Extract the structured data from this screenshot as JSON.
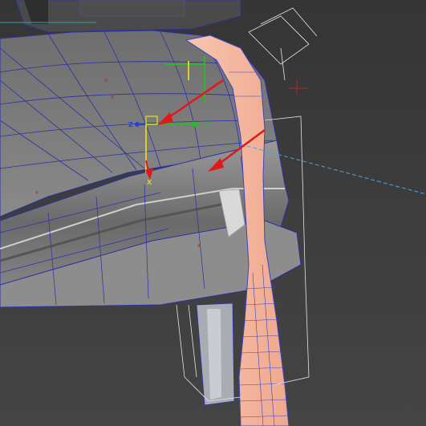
{
  "viewport": {
    "colors": {
      "background": "#3c3c3c",
      "mesh_fill": "#7c7c7c",
      "wire": "#2b2fa8",
      "selected_fill": "#f4b49b",
      "selected_wire": "#3845c8",
      "gizmo_x": "#d6d02a",
      "gizmo_y": "#2fb62f",
      "gizmo_z": "#2a3fe0",
      "arrow": "#e01818",
      "bounding_box": "#e6e6e6",
      "light_ray": "#4ea3e0"
    },
    "gizmo": {
      "label_x": "X",
      "label_y": "Y",
      "label_z": "Z"
    },
    "pivot_markers": [
      "x",
      "x",
      "x",
      "x"
    ],
    "icons": [
      "move-gizmo-icon",
      "annotation-arrow-icon",
      "light-target-icon"
    ]
  }
}
